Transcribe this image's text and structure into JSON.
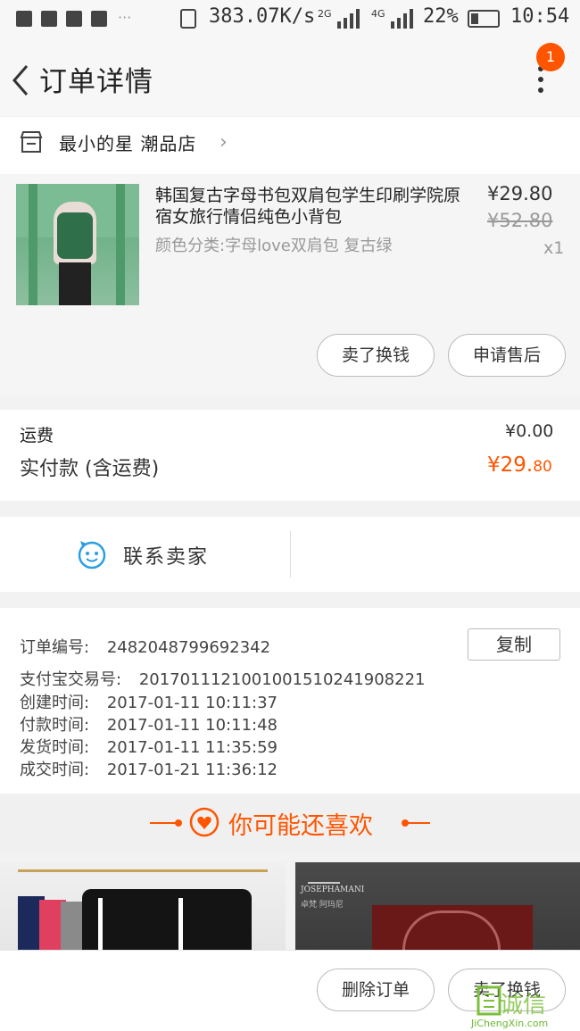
{
  "status_bar": {
    "speed": "383.07K/s",
    "net1": "2G",
    "net2": "4G",
    "battery": "22%",
    "time": "10:54"
  },
  "header": {
    "title": "订单详情",
    "badge_count": "1"
  },
  "store": {
    "name": "最小的星 潮品店"
  },
  "product": {
    "title": "韩国复古字母书包双肩包学生印刷学院原宿女旅行情侣纯色小背包",
    "sku": "颜色分类:字母love双肩包 复古绿",
    "price": "¥29.80",
    "original_price": "¥52.80",
    "quantity": "x1",
    "actions": [
      "卖了换钱",
      "申请售后"
    ]
  },
  "costs": {
    "shipping_label": "运费",
    "shipping_value": "¥0.00",
    "paid_label": "实付款 (含运费)",
    "paid_value_main": "¥29.",
    "paid_value_cents": "80"
  },
  "contact": {
    "label": "联系卖家"
  },
  "order_info": {
    "copy_label": "复制",
    "rows": [
      {
        "label": "订单编号:",
        "value": "2482048799692342"
      },
      {
        "label": "支付宝交易号:",
        "value": "2017011121001001510241908221"
      },
      {
        "label": "创建时间:",
        "value": "2017-01-11 10:11:37"
      },
      {
        "label": "付款时间:",
        "value": "2017-01-11 10:11:48"
      },
      {
        "label": "发货时间:",
        "value": "2017-01-11 11:35:59"
      },
      {
        "label": "成交时间:",
        "value": "2017-01-21 11:36:12"
      }
    ]
  },
  "recommend": {
    "title": "你可能还喜欢",
    "brand": "JOSEPHAMANI",
    "brand_sub": "卓梵 阿玛尼"
  },
  "bottom_bar": {
    "delete_label": "删除订单",
    "sell_label": "卖了换钱"
  },
  "watermark": {
    "text": "诚信",
    "url": "JiChengXin.com"
  },
  "colors": {
    "accent": "#ff5500",
    "background": "#f2f2f2"
  }
}
